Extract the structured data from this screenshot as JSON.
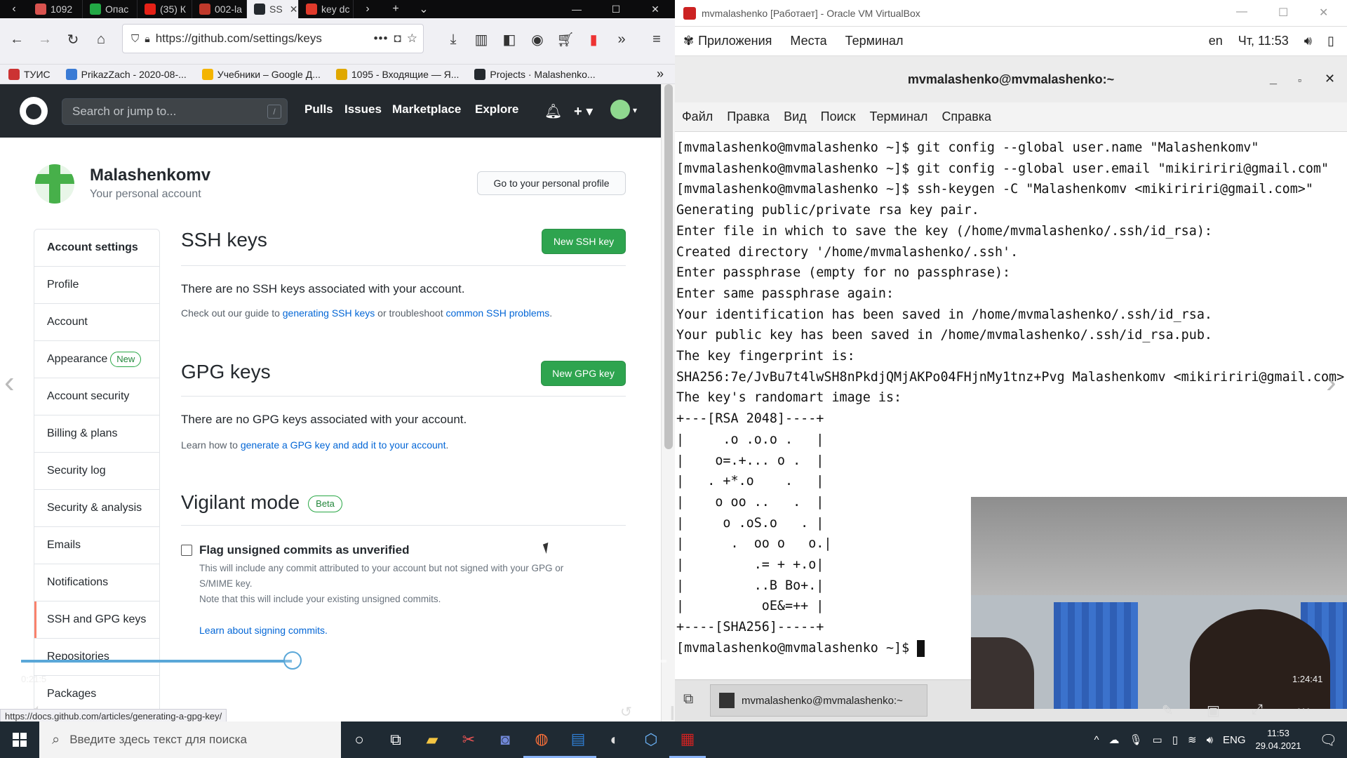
{
  "firefox": {
    "tabs": [
      {
        "label": "1092",
        "color": "#d9534f"
      },
      {
        "label": "Опас",
        "color": "#22a845"
      },
      {
        "label": "(35) К",
        "color": "#e62117"
      },
      {
        "label": "002-la",
        "color": "#c0392b"
      },
      {
        "label": "SS",
        "color": "#24292e",
        "active": true
      },
      {
        "label": "key dc",
        "color": "#e03a2b"
      }
    ],
    "url": "https://github.com/settings/keys",
    "bookmarks": [
      {
        "label": "ТУИС",
        "color": "#cc3333"
      },
      {
        "label": "PrikazZach - 2020-08-...",
        "color": "#3a7bd5"
      },
      {
        "label": "Учебники – Google Д...",
        "color": "#f4b400"
      },
      {
        "label": "1095 - Входящие — Я...",
        "color": "#e0a800"
      },
      {
        "label": "Projects · Malashenko...",
        "color": "#24292e"
      }
    ],
    "status_url": "https://docs.github.com/articles/generating-a-gpg-key/"
  },
  "github": {
    "search_placeholder": "Search or jump to...",
    "search_key": "/",
    "nav": [
      "Pulls",
      "Issues",
      "Marketplace",
      "Explore"
    ],
    "username": "Malashenkomv",
    "user_sub": "Your personal account",
    "profile_button": "Go to your personal profile",
    "sidebar": [
      {
        "label": "Account settings"
      },
      {
        "label": "Profile"
      },
      {
        "label": "Account"
      },
      {
        "label": "Appearance",
        "badge": "New"
      },
      {
        "label": "Account security"
      },
      {
        "label": "Billing & plans"
      },
      {
        "label": "Security log"
      },
      {
        "label": "Security & analysis"
      },
      {
        "label": "Emails"
      },
      {
        "label": "Notifications"
      },
      {
        "label": "SSH and GPG keys",
        "selected": true
      },
      {
        "label": "Repositories"
      },
      {
        "label": "Packages"
      }
    ],
    "ssh": {
      "title": "SSH keys",
      "button": "New SSH key",
      "empty": "There are no SSH keys associated with your account.",
      "guide_pre": "Check out our guide to ",
      "guide_link1": "generating SSH keys",
      "guide_mid": " or troubleshoot ",
      "guide_link2": "common SSH problems",
      "guide_post": "."
    },
    "gpg": {
      "title": "GPG keys",
      "button": "New GPG key",
      "empty": "There are no GPG keys associated with your account.",
      "learn_pre": "Learn how to ",
      "learn_link": "generate a GPG key and add it to your account",
      "learn_post": "."
    },
    "vigilant": {
      "title": "Vigilant mode",
      "badge": "Beta",
      "checkbox_label": "Flag unsigned commits as unverified",
      "desc1": "This will include any commit attributed to your account but not signed with your GPG or",
      "desc2": "S/MIME key.",
      "desc3": "Note that this will include your existing unsigned commits.",
      "link": "Learn about signing commits."
    }
  },
  "video": {
    "elapsed": "0:21:5",
    "remaining": "1:24:41",
    "progress": 0.42
  },
  "vbox": {
    "title": "mvmalashenko [Работает] - Oracle VM VirtualBox",
    "gnome_menu": [
      "Приложения",
      "Места",
      "Терминал"
    ],
    "gnome_right": [
      "en",
      "Чт, 11:53"
    ],
    "terminal_title": "mvmalashenko@mvmalashenko:~",
    "terminal_menu": [
      "Файл",
      "Правка",
      "Вид",
      "Поиск",
      "Терминал",
      "Справка"
    ],
    "terminal_lines": [
      "[mvmalashenko@mvmalashenko ~]$ git config --global user.name \"Malashenkomv\"",
      "[mvmalashenko@mvmalashenko ~]$ git config --global user.email \"mikiririri@gmail.com\"",
      "[mvmalashenko@mvmalashenko ~]$ ssh-keygen -C \"Malashenkomv <mikiririri@gmail.com>\"",
      "Generating public/private rsa key pair.",
      "Enter file in which to save the key (/home/mvmalashenko/.ssh/id_rsa):",
      "Created directory '/home/mvmalashenko/.ssh'.",
      "Enter passphrase (empty for no passphrase):",
      "Enter same passphrase again:",
      "Your identification has been saved in /home/mvmalashenko/.ssh/id_rsa.",
      "Your public key has been saved in /home/mvmalashenko/.ssh/id_rsa.pub.",
      "The key fingerprint is:",
      "SHA256:7e/JvBu7t4lwSH8nPkdjQMjAKPo04FHjnMy1tnz+Pvg Malashenkomv <mikiririri@gmail.com>",
      "The key's randomart image is:",
      "+---[RSA 2048]----+",
      "|     .o .o.o .   |",
      "|    o=.+... o .  |",
      "|   . +*.o    .   |",
      "|    o oo ..   .  |",
      "|     o .oS.o   . |",
      "|      .  oo o   o.|",
      "|         .= + +.o|",
      "|         ..B Bo+.|",
      "|          oE&=++ |",
      "+----[SHA256]-----+"
    ],
    "prompt": "[mvmalashenko@mvmalashenko ~]$ ",
    "vm_task": "mvmalashenko@mvmalashenko:~"
  },
  "windows": {
    "search_placeholder": "Введите здесь текст для поиска",
    "lang": "ENG",
    "time": "11:53",
    "date": "29.04.2021"
  }
}
